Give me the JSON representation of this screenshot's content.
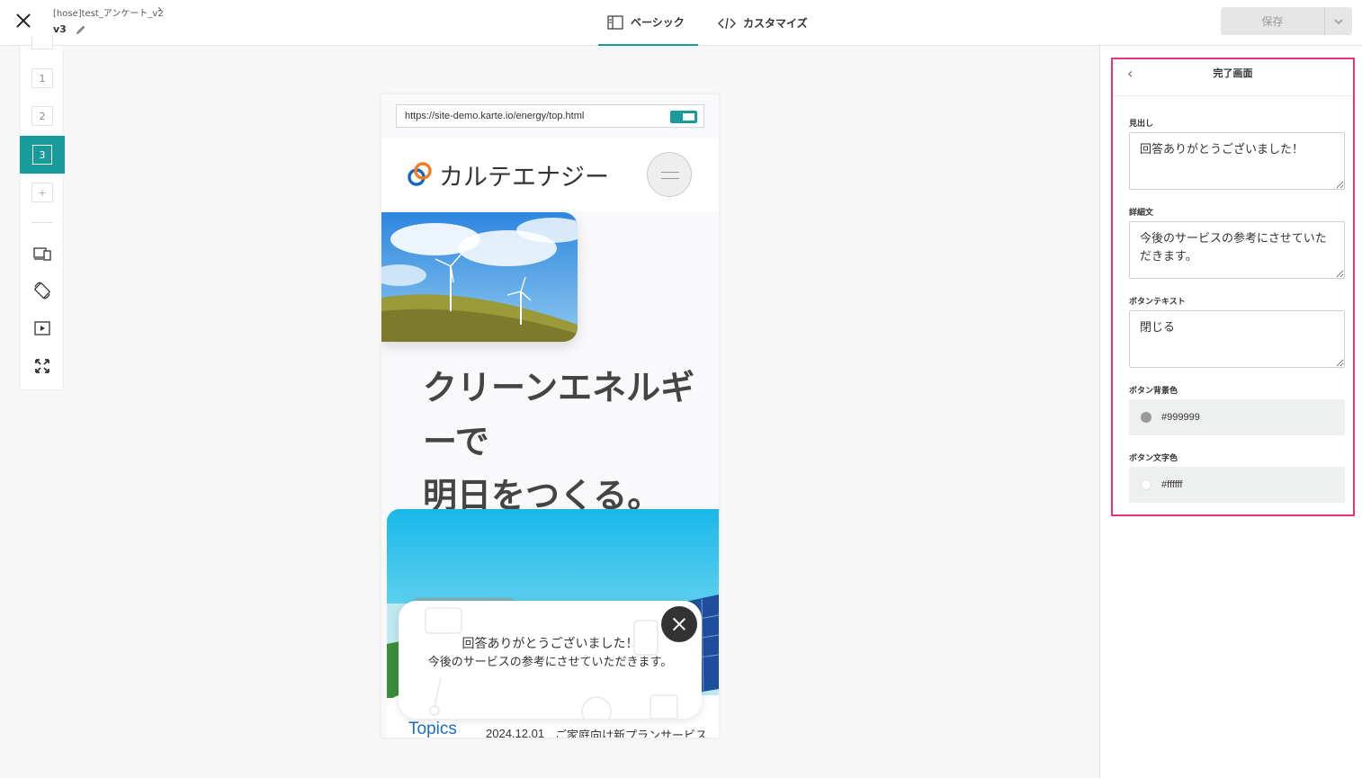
{
  "header": {
    "project_name": "[hose]test_アンケート_v2",
    "version": "v3",
    "tabs": [
      {
        "label": "ベーシック",
        "active": true
      },
      {
        "label": "カスタマイズ",
        "active": false
      }
    ],
    "save_label": "保存"
  },
  "left_toolbar": {
    "steps": [
      "1",
      "2",
      "3"
    ],
    "active_step": "3",
    "add_label": "+"
  },
  "preview": {
    "url": "https://site-demo.karte.io/energy/top.html",
    "brand_name": "カルテエナジー",
    "headline": [
      "クリーンエネルギ",
      "ーで",
      "明日をつくる。"
    ],
    "topics_title": "Topics",
    "topics_date": "2024.12.01",
    "topics_news": "ご家庭向け新プランサービス",
    "popup": {
      "heading": "回答ありがとうございました！",
      "detail": "今後のサービスの参考にさせていただきます。"
    }
  },
  "panel": {
    "title": "完了画面",
    "heading_label": "見出し",
    "heading_value": "回答ありがとうございました！",
    "detail_label": "詳細文",
    "detail_value": "今後のサービスの参考にさせていただきます。",
    "button_text_label": "ボタンテキスト",
    "button_text_value": "閉じる",
    "button_bg_label": "ボタン背景色",
    "button_bg_value": "#999999",
    "button_fg_label": "ボタン文字色",
    "button_fg_value": "#ffffff"
  },
  "colors": {
    "accent": "#1a9b9b",
    "highlight_frame": "#e8337a",
    "link_blue": "#1a6fc2"
  }
}
